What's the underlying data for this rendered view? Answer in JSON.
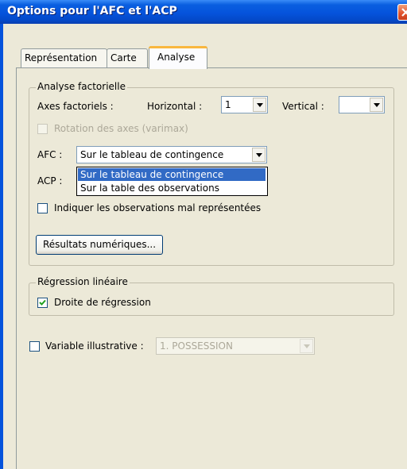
{
  "window": {
    "title": "Options pour l'AFC et l'ACP"
  },
  "tabs": [
    {
      "label": "Représentation",
      "active": false
    },
    {
      "label": "Carte",
      "active": false
    },
    {
      "label": "Analyse",
      "active": true
    }
  ],
  "analyse_factorielle": {
    "legend": "Analyse factorielle",
    "axes_label": "Axes factoriels :",
    "horizontal_label": "Horizontal :",
    "horizontal_value": "1",
    "vertical_label": "Vertical :",
    "vertical_value": "",
    "rotation_label": "Rotation des axes (varimax)",
    "afc_label": "AFC :",
    "afc_value": "Sur le tableau de contingence",
    "acp_label": "ACP :",
    "dropdown_options": [
      "Sur le tableau de contingence",
      "Sur la table des observations"
    ],
    "mal_representees_label": "Indiquer les observations mal représentées",
    "resultats_button": "Résultats numériques..."
  },
  "regression": {
    "legend": "Régression linéaire",
    "droite_label": "Droite de régression",
    "droite_checked": true
  },
  "variable_illustrative": {
    "label": "Variable illustrative :",
    "value": "1. POSSESSION",
    "checked": false
  },
  "colors": {
    "titlebar": "#0553dc",
    "selection": "#316ac5",
    "dialog": "#ece9d8"
  },
  "icons": {
    "close": "close-icon",
    "dropdown_arrow": "chevron-down-icon",
    "check": "check-icon"
  }
}
